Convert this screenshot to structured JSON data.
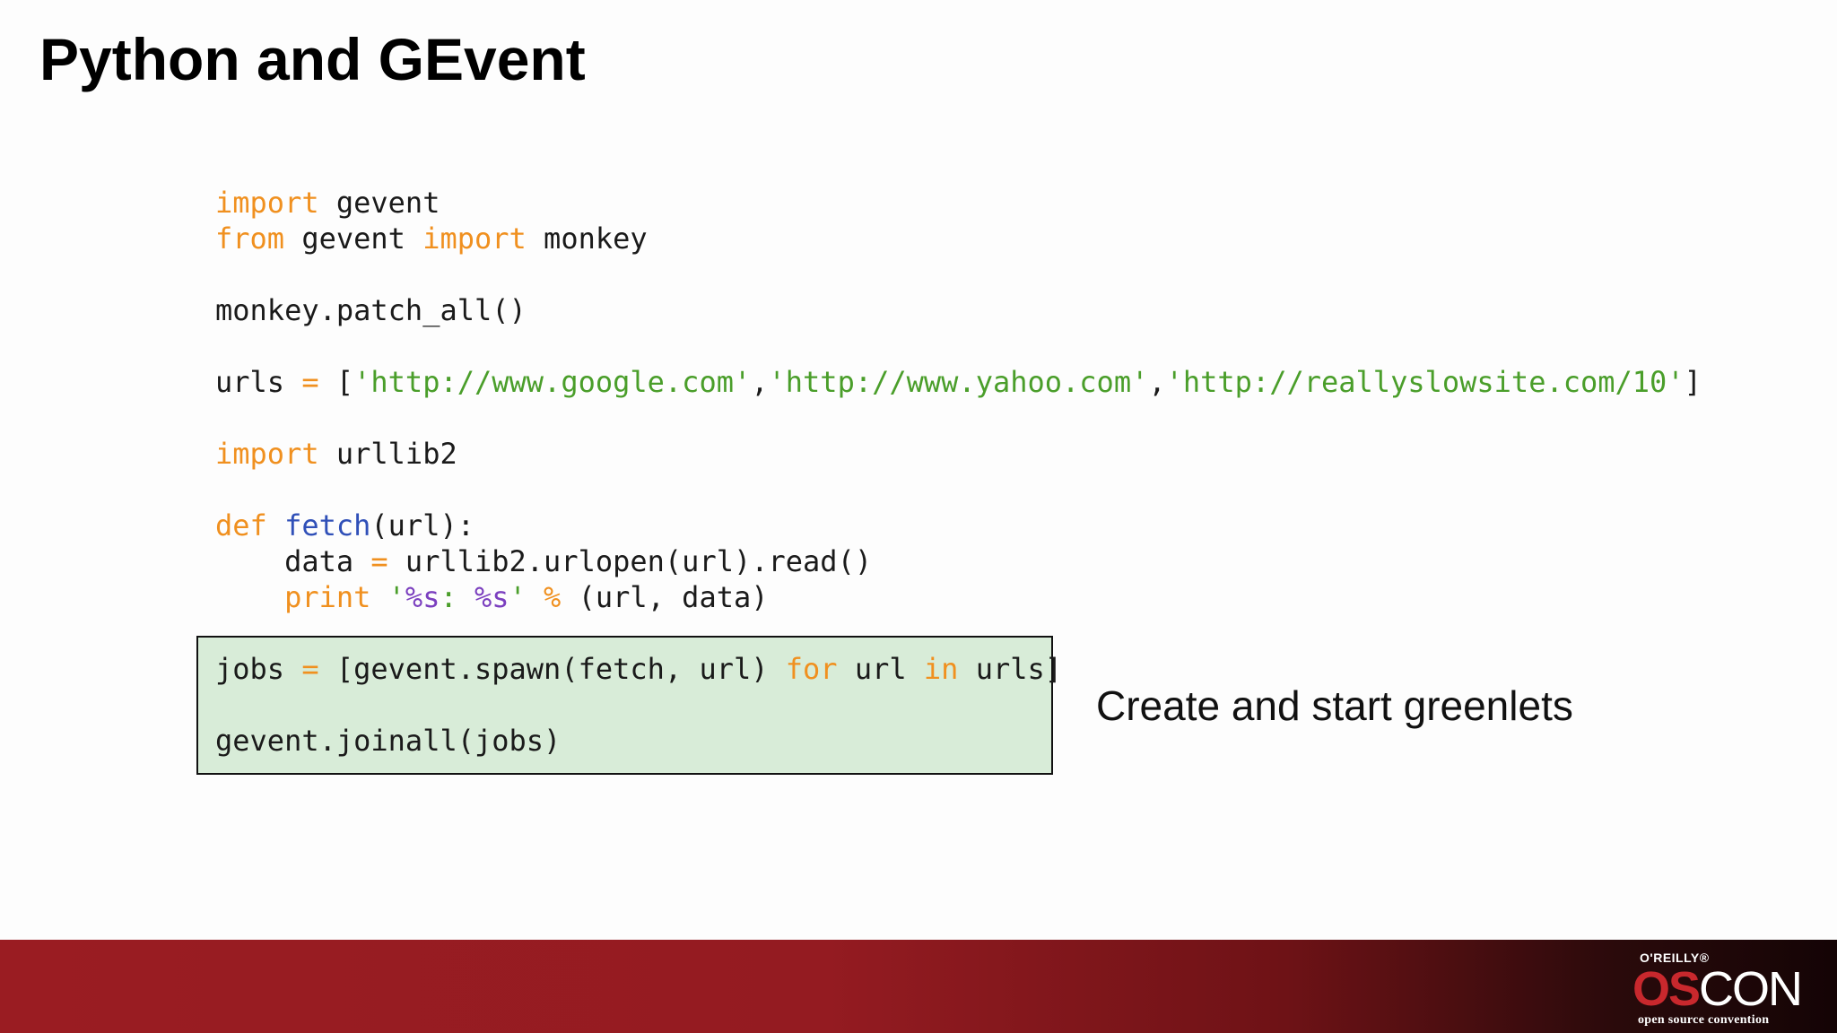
{
  "slide": {
    "title": "Python and GEvent",
    "annotation": "Create and start greenlets"
  },
  "code": {
    "line1": {
      "kw_import": "import",
      "text": " gevent"
    },
    "line2": {
      "kw_from": "from",
      "text1": " gevent ",
      "kw_import": "import",
      "text2": " monkey"
    },
    "line4": {
      "text": "monkey.patch_all()"
    },
    "line6": {
      "var": "urls ",
      "op": "=",
      "open": " [",
      "url1": "'http://www.google.com'",
      "sep1": ",",
      "url2": "'http://www.yahoo.com'",
      "sep2": ",",
      "url3": "'http://reallyslowsite.com/10'",
      "close": "]"
    },
    "line8": {
      "kw_import": "import",
      "text": " urllib2"
    },
    "line10": {
      "kw_def": "def",
      "space": " ",
      "fn_name": "fetch",
      "args": "(url):"
    },
    "line11": {
      "indent": "    ",
      "var": "data ",
      "op": "=",
      "text": " urllib2.urlopen(url).read()"
    },
    "line12": {
      "indent": "    ",
      "kw_print": "print",
      "space": " ",
      "q1": "'",
      "fmt1": "%s",
      "colon": ": ",
      "fmt2": "%s",
      "q2": "'",
      "space2": " ",
      "op": "%",
      "args": " (url, data)"
    },
    "line14": {
      "var": "jobs ",
      "op": "=",
      "text1": " [gevent.spawn(fetch, url) ",
      "kw_for": "for",
      "text2": " url ",
      "kw_in": "in",
      "text3": " urls]"
    },
    "line16": {
      "text": "gevent.joinall(jobs)"
    }
  },
  "footer": {
    "publisher": "O'REILLY®",
    "brand_os": "OS",
    "brand_con": "CON",
    "tagline": "open source convention",
    "band_color_start": "#9a1c22",
    "band_color_end": "#140405"
  },
  "colors": {
    "keyword": "#f0901f",
    "string": "#4a9e2a",
    "function_name": "#3050b8",
    "format_spec": "#7b3fbf",
    "highlight_fill": "#d8ecd8"
  }
}
